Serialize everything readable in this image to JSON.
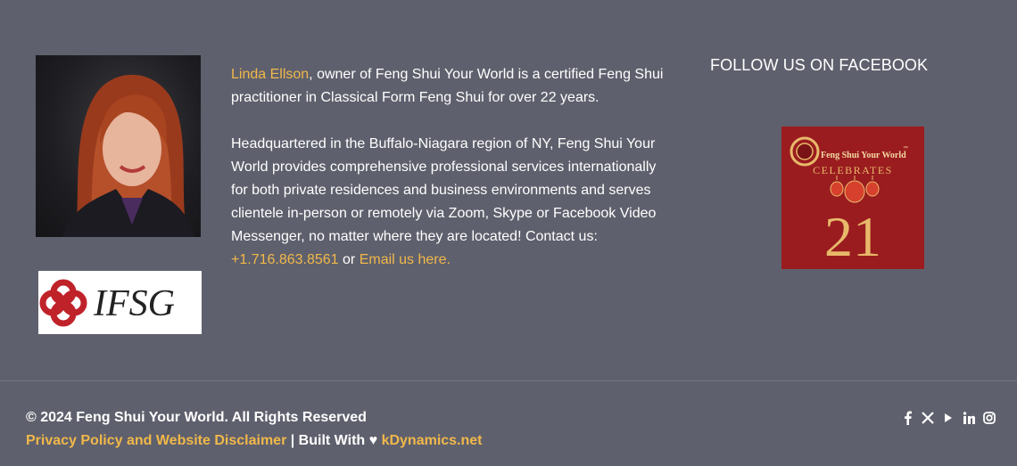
{
  "bio": {
    "owner_name": "Linda Ellson",
    "intro_text": ", owner of Feng Shui Your World is a certified Feng Shui practitioner in Classical Form Feng Shui for over 22 years.",
    "hq_text": "Headquartered in the Buffalo-Niagara region of NY, Feng Shui Your World provides comprehensive professional services internationally for both private residences and business environments and serves clientele in-person or remotely via Zoom, Skype or Facebook Video Messenger, no matter where they are located! Contact us:",
    "phone": "+1.716.863.8561",
    "or_text": " or ",
    "email_link": "Email us here."
  },
  "logos": {
    "ifsg_text": "IFSG"
  },
  "facebook": {
    "heading": "FOLLOW US ON FACEBOOK",
    "badge_brand": "Feng Shui Your World",
    "badge_tm": "™",
    "badge_celebrates": "CELEBRATES",
    "badge_number": "21"
  },
  "footer": {
    "copyright": "© 2024 Feng Shui Your World. All Rights Reserved",
    "privacy_link": "Privacy Policy and Website Disclaimer",
    "built_with": " | Built With ♥ ",
    "kdynamics_link": "kDynamics.net"
  },
  "social_icons": [
    "facebook-icon",
    "x-icon",
    "youtube-icon",
    "linkedin-icon",
    "instagram-icon"
  ],
  "colors": {
    "background": "#5f606d",
    "accent": "#f0b84a",
    "badge_red": "#9a1c1f",
    "badge_gold": "#e8b96a"
  }
}
